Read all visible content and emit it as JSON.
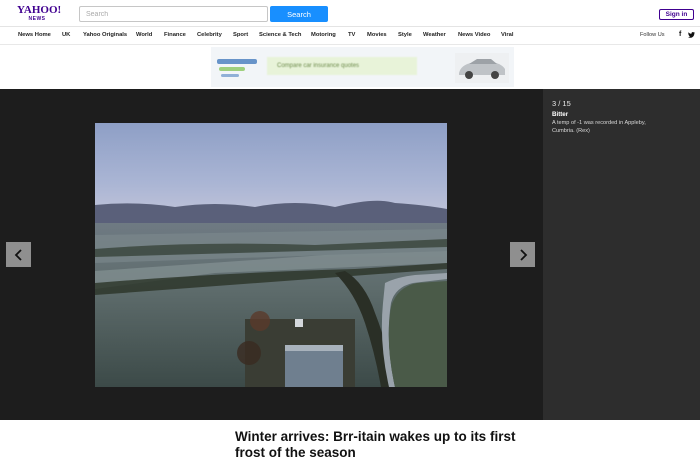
{
  "header": {
    "logo_top": "YAHOO!",
    "logo_bottom": "NEWS",
    "search_placeholder": "Search",
    "search_button": "Search",
    "sign_in": "Sign in"
  },
  "nav": {
    "items": [
      "News Home",
      "UK",
      "Yahoo Originals",
      "World",
      "Finance",
      "Celebrity",
      "Sport",
      "Science & Tech",
      "Motoring",
      "TV",
      "Movies",
      "Style",
      "Weather",
      "News Video",
      "Viral"
    ],
    "follow_label": "Follow Us",
    "facebook": "f",
    "twitter": "twitter-icon"
  },
  "ad": {
    "brand_color": "#2e6bb5",
    "banner_text": "Compare car insurance quotes"
  },
  "slideshow": {
    "counter": "3 / 15",
    "caption_title": "Bitter",
    "caption_text": "A temp of -1 was recorded in Appleby, Cumbria. (Rex)",
    "prev_icon": "chevron-left-icon",
    "next_icon": "chevron-right-icon"
  },
  "article": {
    "headline": "Winter arrives: Brr-itain wakes up to its first frost of the season"
  }
}
